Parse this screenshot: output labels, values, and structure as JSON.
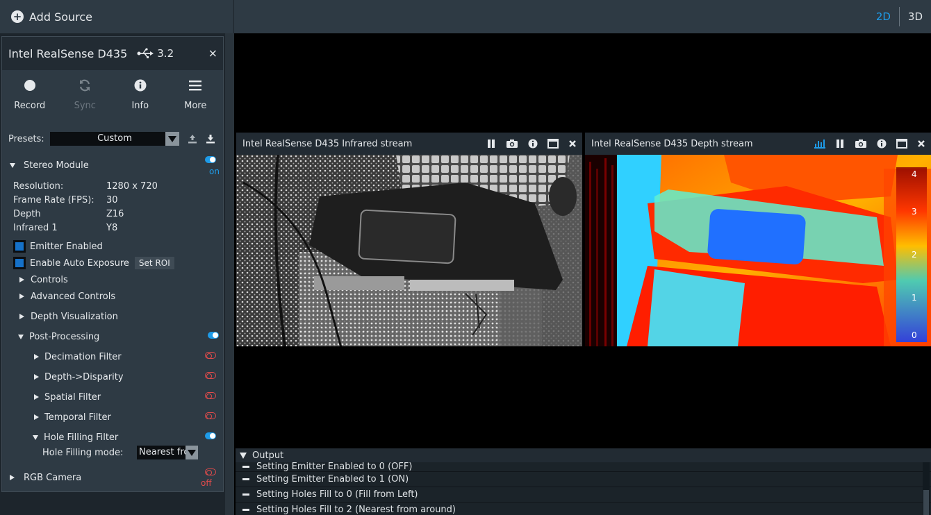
{
  "topbar": {
    "add_source": "Add Source",
    "view_2d": "2D",
    "view_3d": "3D"
  },
  "device": {
    "name": "Intel RealSense D435",
    "usb": "3.2",
    "close": "×",
    "toolbar": {
      "record": "Record",
      "sync": "Sync",
      "info": "Info",
      "more": "More"
    },
    "presets": {
      "label": "Presets:",
      "value": "Custom"
    },
    "stereo": {
      "label": "Stereo Module",
      "state": "on",
      "fields": [
        {
          "k": "Resolution:",
          "v": "1280 x 720"
        },
        {
          "k": "Frame Rate (FPS):",
          "v": "30"
        },
        {
          "k": "Depth",
          "v": "Z16"
        },
        {
          "k": "Infrared 1",
          "v": "Y8"
        }
      ],
      "emitter": "Emitter Enabled",
      "auto_exposure": "Enable Auto Exposure",
      "set_roi": "Set ROI",
      "controls": "Controls",
      "advanced": "Advanced Controls",
      "depth_vis": "Depth Visualization",
      "post": "Post-Processing",
      "filters": [
        "Decimation Filter",
        "Depth->Disparity",
        "Spatial Filter",
        "Temporal Filter",
        "Hole Filling Filter"
      ],
      "hole_mode_label": "Hole Filling mode:",
      "hole_mode_value": "Nearest fro"
    },
    "rgb": {
      "label": "RGB Camera",
      "state": "off"
    }
  },
  "streams": {
    "infrared": {
      "title": "Intel RealSense D435 Infrared stream"
    },
    "depth": {
      "title": "Intel RealSense D435 Depth stream",
      "scale": [
        "4",
        "3",
        "2",
        "1",
        "0"
      ]
    }
  },
  "output": {
    "title": "Output",
    "lines": [
      "Setting Emitter Enabled to 0 (OFF)",
      "Setting Emitter Enabled to 1 (ON)",
      "Setting Holes Fill to 0 (Fill from Left)",
      "Setting Holes Fill to 2 (Nearest from around)"
    ]
  },
  "colors": {
    "accent": "#1e9be8",
    "off": "#e24b4b",
    "panel": "#2e3a44"
  }
}
